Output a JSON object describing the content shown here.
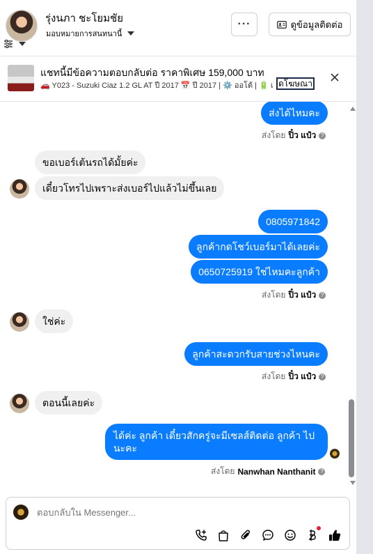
{
  "header": {
    "contact_name": "รุ่งนภา ชะโยมชัย",
    "assign_label": "มอบหมายการสนทนานี้",
    "more_label": "···",
    "contact_info_label": "ดูข้อมูลติดต่อ"
  },
  "ad": {
    "title": "แชทนี้มีข้อความตอบกลับต่อ ราคาพิเศษ 159,000 บาท",
    "subtitle": "🚗 Y023 - Suzuki Ciaz 1.2 GL AT ปี 2017 📅 ปี 2017 | ⚙️ ออโต้ | 🔋 เ...",
    "link_label": "ดโฆษณา"
  },
  "messages": {
    "m1": "ส่งได้ไหมคะ",
    "m2": "ขอเบอร์เต้นรถได้มั้ยค่ะ",
    "m3": "เดี๋ยวโทรไปเพราะส่งเบอร์ไปแล้วไม่ขึ้นเลย",
    "m4": "0805971842",
    "m5": "ลูกค้ากดโชว์เบอร์มาได้เลยค่ะ",
    "m6": "0650725919  ใช่ไหมคะลูกค้า",
    "m7": "ใช่ค่ะ",
    "m8": "ลูกค้าสะดวกรับสายช่วงไหนคะ",
    "m9": "ตอนนี้เลยค่ะ",
    "m10_line1": "ได้ค่ะ  ลูกค้า เดี๋ยวสักครู่จะมีเซลส์ติดต่อ ลูกค้า ไป",
    "m10_line2": "นะคะ"
  },
  "sentby": {
    "prefix": "ส่งโดย",
    "agent1": "ปิ๋ว แป๋ว",
    "agent2": "Nanwhan Nanthanit",
    "help_mark": "?"
  },
  "composer": {
    "placeholder": "ตอบกลับใน Messenger..."
  },
  "colors": {
    "outgoing_bubble": "#0a7cff",
    "incoming_bubble": "#f0f0f0",
    "notification_dot": "#e41e3f"
  }
}
